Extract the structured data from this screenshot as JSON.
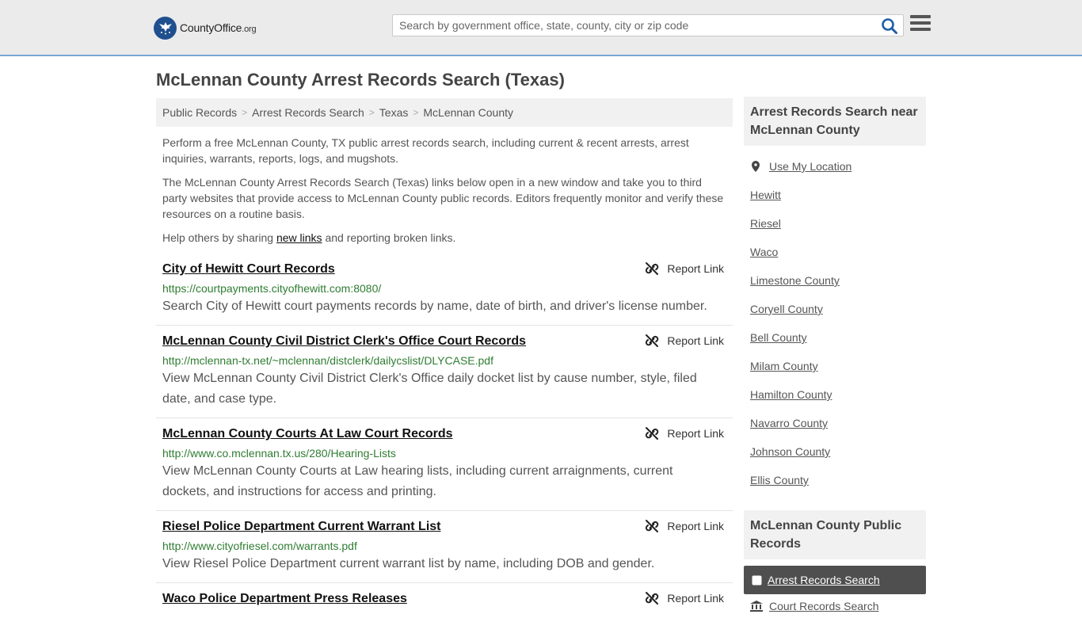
{
  "header": {
    "logo_main": "CountyOffice",
    "logo_suffix": ".org",
    "search_placeholder": "Search by government office, state, county, city or zip code"
  },
  "page": {
    "title": "McLennan County Arrest Records Search (Texas)"
  },
  "breadcrumb": [
    "Public Records",
    "Arrest Records Search",
    "Texas",
    "McLennan County"
  ],
  "intro": {
    "p1": "Perform a free McLennan County, TX public arrest records search, including current & recent arrests, arrest inquiries, warrants, reports, logs, and mugshots.",
    "p2": "The McLennan County Arrest Records Search (Texas) links below open in a new window and take you to third party websites that provide access to McLennan County public records. Editors frequently monitor and verify these resources on a routine basis.",
    "p3_before": "Help others by sharing ",
    "p3_link": "new links",
    "p3_after": " and reporting broken links."
  },
  "report_label": "Report Link",
  "results": [
    {
      "title": "City of Hewitt Court Records",
      "url": "https://courtpayments.cityofhewitt.com:8080/",
      "desc": "Search City of Hewitt court payments records by name, date of birth, and driver's license number."
    },
    {
      "title": "McLennan County Civil District Clerk's Office Court Records",
      "url": "http://mclennan-tx.net/~mclennan/distclerk/dailycslist/DLYCASE.pdf",
      "desc": "View McLennan County Civil District Clerk's Office daily docket list by cause number, style, filed date, and case type."
    },
    {
      "title": "McLennan County Courts At Law Court Records",
      "url": "http://www.co.mclennan.tx.us/280/Hearing-Lists",
      "desc": "View McLennan County Courts at Law hearing lists, including current arraignments, current dockets, and instructions for access and printing."
    },
    {
      "title": "Riesel Police Department Current Warrant List",
      "url": "http://www.cityofriesel.com/warrants.pdf",
      "desc": "View Riesel Police Department current warrant list by name, including DOB and gender."
    },
    {
      "title": "Waco Police Department Press Releases",
      "url": "",
      "desc": ""
    }
  ],
  "sidebar": {
    "nearby_heading": "Arrest Records Search near McLennan County",
    "use_location": "Use My Location",
    "nearby": [
      "Hewitt",
      "Riesel",
      "Waco",
      "Limestone County",
      "Coryell County",
      "Bell County",
      "Milam County",
      "Hamilton County",
      "Navarro County",
      "Johnson County",
      "Ellis County"
    ],
    "public_heading": "McLennan County Public Records",
    "active_item": "Arrest Records Search",
    "next_item": "Court Records Search"
  },
  "colors": {
    "accent_border": "#7aa6d6",
    "url_green": "#2f7d32",
    "logo_blue": "#1f4f8f",
    "active_bg": "#4f4f4f"
  }
}
